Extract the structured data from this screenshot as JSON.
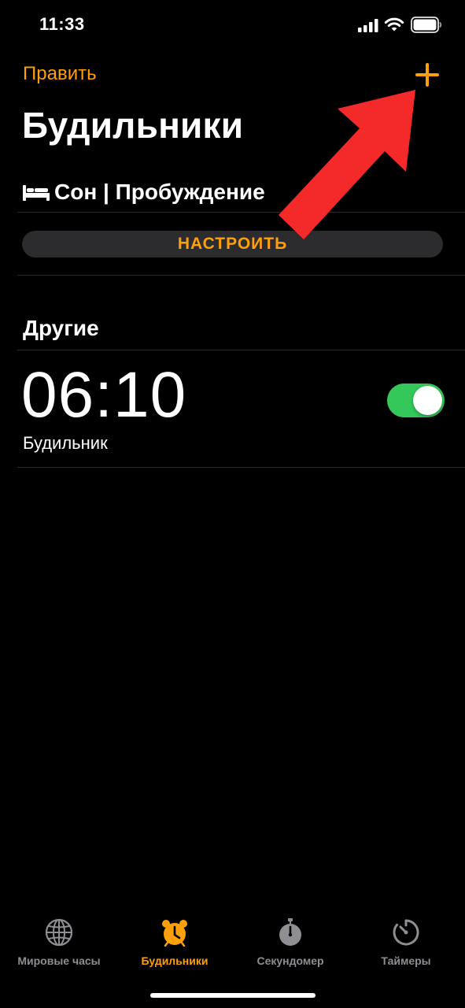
{
  "status_bar": {
    "time": "11:33"
  },
  "nav": {
    "edit_label": "Править"
  },
  "header": {
    "title": "Будильники"
  },
  "sleep": {
    "label": "Сон | Пробуждение",
    "setup_label": "НАСТРОИТЬ"
  },
  "others": {
    "title": "Другие",
    "alarms": [
      {
        "time": "06:10",
        "label": "Будильник",
        "enabled": true
      }
    ]
  },
  "tabs": [
    {
      "label": "Мировые часы",
      "icon": "globe-icon",
      "active": false
    },
    {
      "label": "Будильники",
      "icon": "alarm-clock-icon",
      "active": true
    },
    {
      "label": "Секундомер",
      "icon": "stopwatch-icon",
      "active": false
    },
    {
      "label": "Таймеры",
      "icon": "timer-icon",
      "active": false
    }
  ],
  "colors": {
    "accent": "#ff9f0a",
    "toggle_on": "#34c759",
    "annotation": "#f42a2a",
    "inactive_tab": "#8e8e93"
  }
}
